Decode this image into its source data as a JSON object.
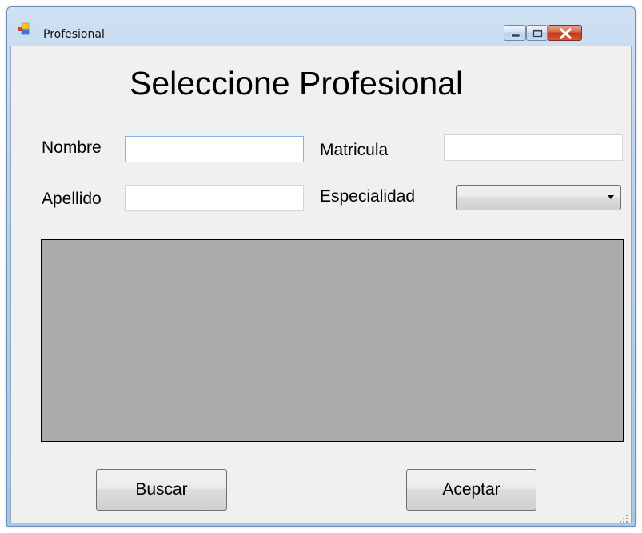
{
  "window": {
    "title": "Profesional",
    "icon": "form-icon",
    "caption_buttons": [
      "minimize-icon",
      "maximize-icon",
      "close-icon"
    ]
  },
  "form": {
    "heading": "Seleccione Profesional",
    "nombre": {
      "label": "Nombre",
      "value": ""
    },
    "matricula": {
      "label": "Matricula",
      "value": ""
    },
    "apellido": {
      "label": "Apellido",
      "value": ""
    },
    "especialidad": {
      "label": "Especialidad",
      "selected": ""
    }
  },
  "results_grid": {
    "rows": []
  },
  "buttons": {
    "buscar": "Buscar",
    "aceptar": "Aceptar"
  },
  "colors": {
    "client_background": "#f0f0f0",
    "grid_background": "#ababab",
    "close_button": "#c94a2e"
  }
}
